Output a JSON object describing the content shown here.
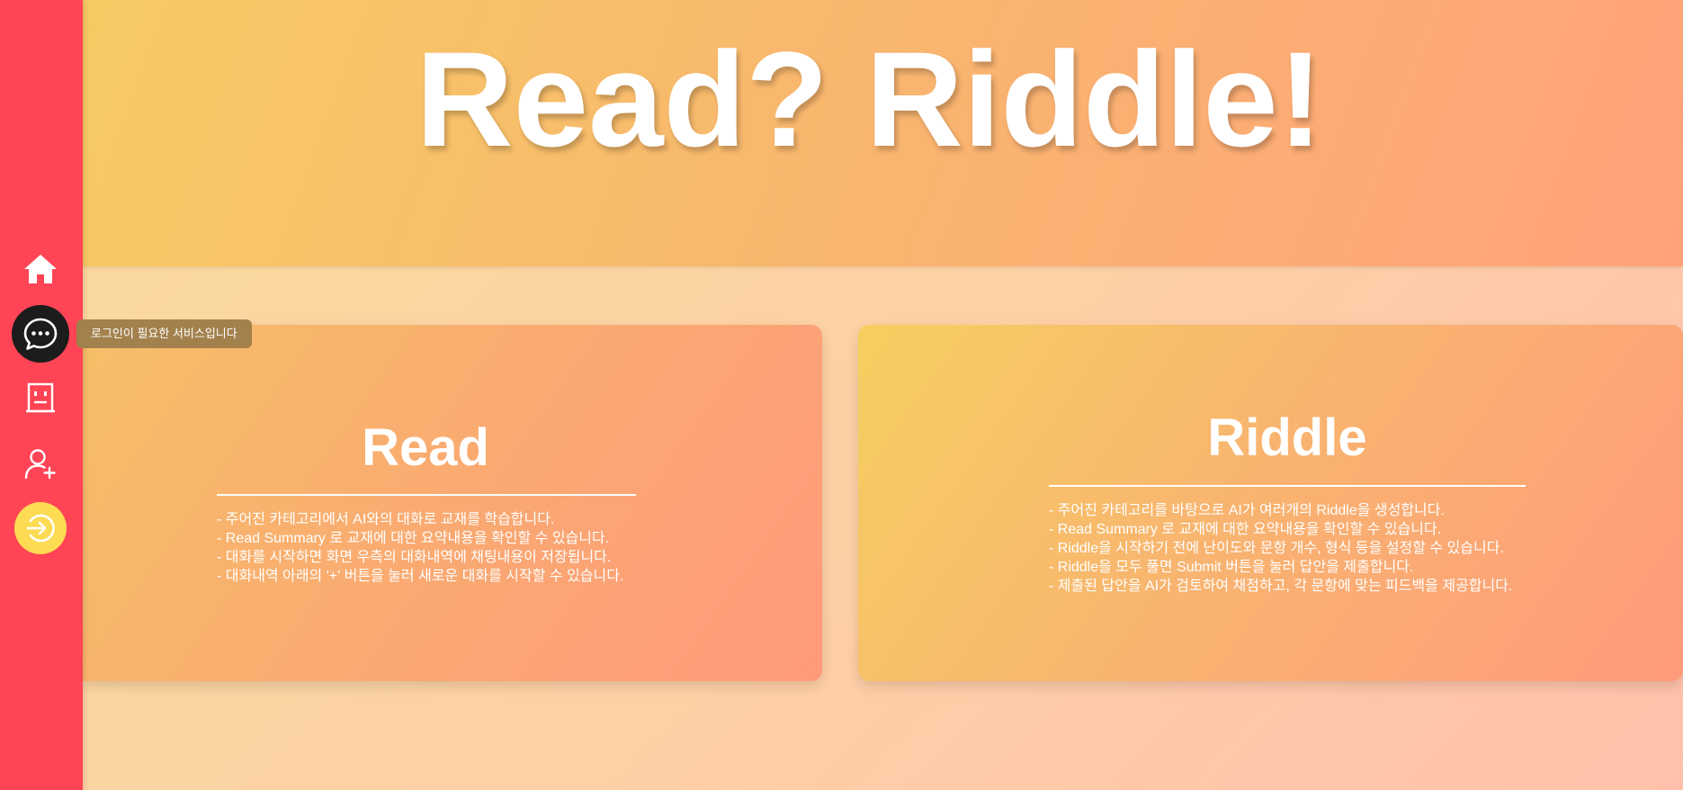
{
  "sidebar": {
    "items": [
      {
        "name": "home",
        "icon": "home-icon"
      },
      {
        "name": "chat",
        "icon": "chat-bubble-icon"
      },
      {
        "name": "robot",
        "icon": "robot-icon"
      },
      {
        "name": "signup",
        "icon": "user-add-icon"
      },
      {
        "name": "login",
        "icon": "login-icon"
      }
    ],
    "tooltip": "로그인이 필요한 서비스입니다"
  },
  "hero": {
    "title": "Read? Riddle!"
  },
  "cards": {
    "read": {
      "title": "Read",
      "lines": [
        "- 주어진 카테고리에서 AI와의 대화로 교재를 학습합니다.",
        "- Read Summary 로 교재에 대한 요약내용을 확인할 수 있습니다.",
        "- 대화를 시작하면 화면 우측의 대화내역에 채팅내용이 저장됩니다.",
        "- 대화내역 아래의 '+' 버튼을 눌러 새로운 대화를 시작할 수 있습니다."
      ]
    },
    "riddle": {
      "title": "Riddle",
      "lines": [
        "- 주어진 카테고리를 바탕으로 AI가 여러개의 Riddle을 생성합니다.",
        "- Read Summary 로 교재에 대한 요약내용을 확인할 수 있습니다.",
        "- Riddle을 시작하기 전에 난이도와 문항 개수, 형식 등을 설정할 수 있습니다.",
        "- Riddle을 모두 풀면 Submit 버튼을 눌러 답안을 제출합니다.",
        "- 제출된 답안을 AI가 검토하여 채점하고, 각 문항에 맞는 피드백을 제공합니다."
      ]
    }
  },
  "colors": {
    "sidebar": "#ff4455",
    "active": "#1c1c1c",
    "login": "#fddb52",
    "tooltip": "#a2814d",
    "text": "#ffffff"
  }
}
